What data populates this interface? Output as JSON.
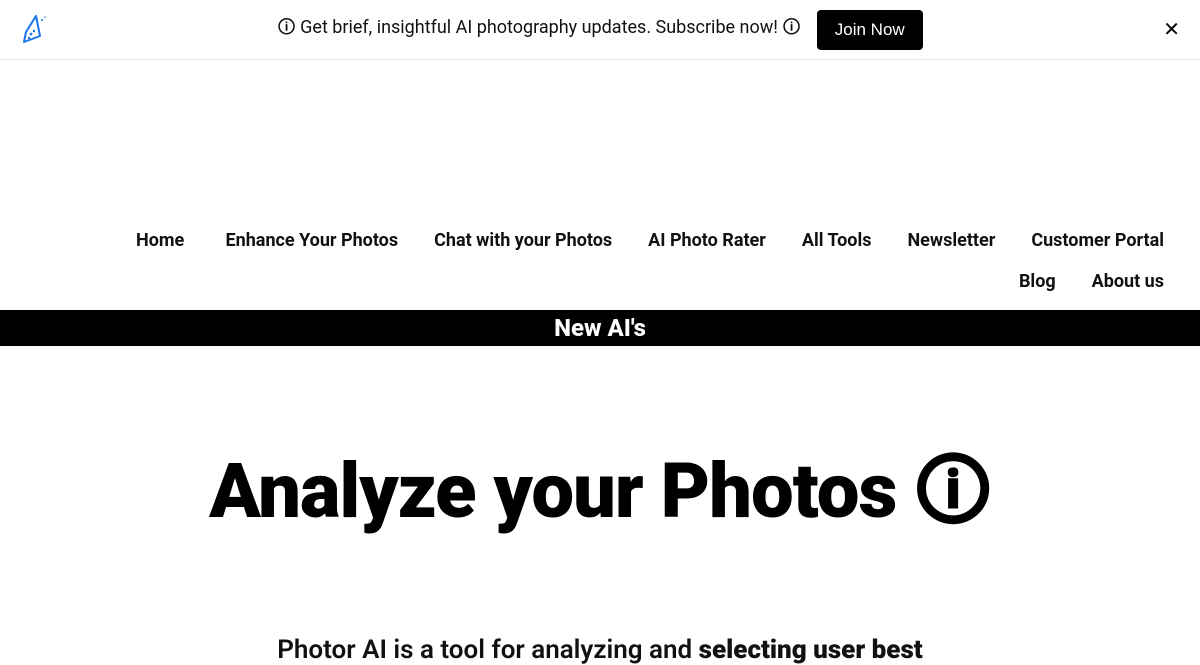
{
  "banner": {
    "text": "🛈 Get brief, insightful AI photography updates. Subscribe now! 🛈",
    "join_label": "Join Now"
  },
  "nav": {
    "home": "Home",
    "enhance": "Enhance Your Photos",
    "chat": "Chat with your Photos",
    "rater": "AI Photo Rater",
    "tools": "All Tools",
    "newsletter": "Newsletter",
    "portal": "Customer Portal",
    "blog": "Blog",
    "about": "About us"
  },
  "strip": {
    "label": "New AI's"
  },
  "hero": {
    "title": "Analyze your Photos 🛈"
  },
  "subtext": {
    "part1": "Photor AI is a tool for analyzing and ",
    "bold": "selecting user best"
  }
}
